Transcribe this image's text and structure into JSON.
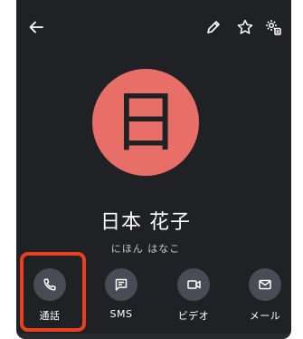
{
  "contact": {
    "initial": "日",
    "name": "日本 花子",
    "reading": "にほん はなこ",
    "avatar_color": "#e86f68"
  },
  "top_bar": {
    "icons": [
      "back-arrow-icon",
      "edit-pencil-icon",
      "star-outline-icon",
      "manage-settings-icon"
    ]
  },
  "actions": [
    {
      "label": "通話",
      "icon": "phone-icon"
    },
    {
      "label": "SMS",
      "icon": "message-icon"
    },
    {
      "label": "ビデオ",
      "icon": "video-icon"
    },
    {
      "label": "メール",
      "icon": "mail-icon"
    }
  ],
  "highlight": {
    "target": "通話",
    "color": "#e8401e"
  },
  "colors": {
    "background": "#202124",
    "action_circle": "#474c55",
    "text_secondary": "#c6c8cc"
  }
}
